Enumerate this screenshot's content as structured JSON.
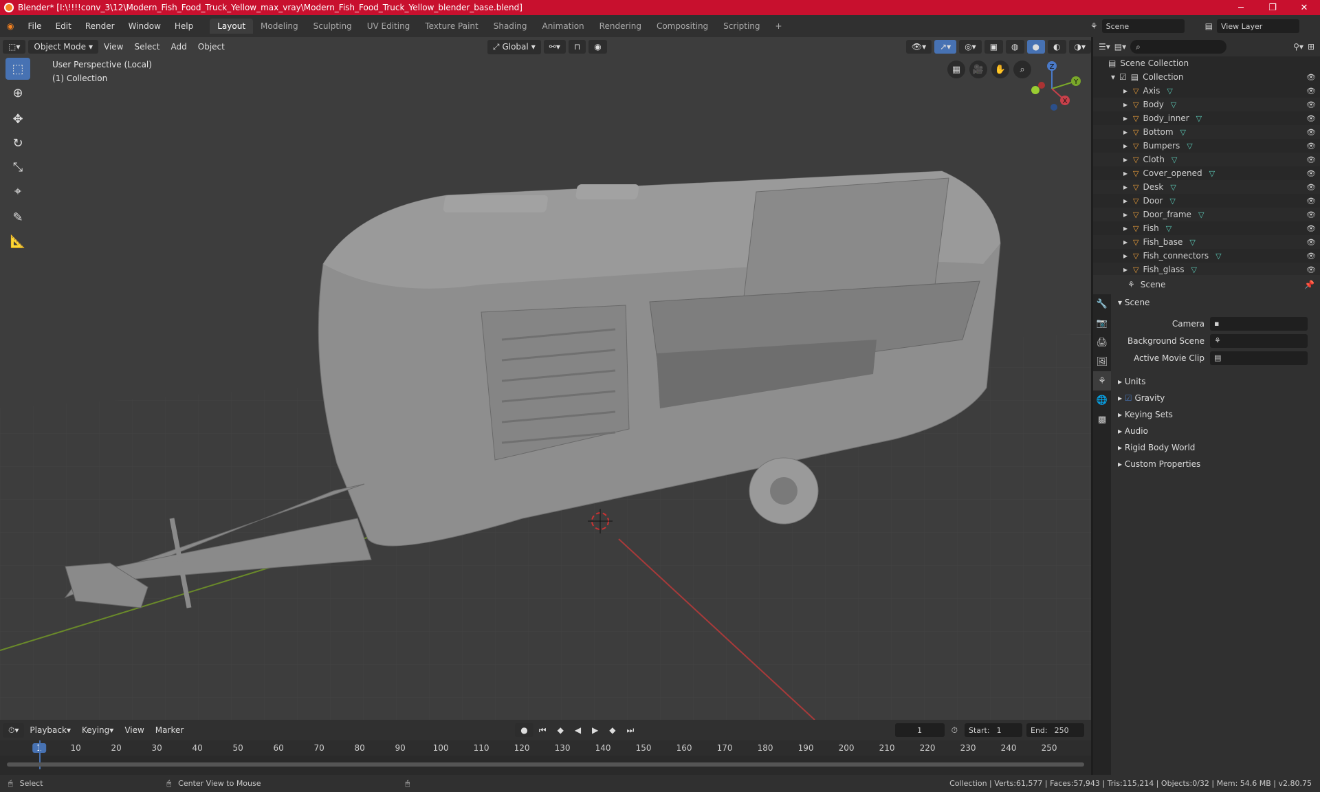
{
  "title": "Blender* [I:\\!!!!conv_3\\12\\Modern_Fish_Food_Truck_Yellow_max_vray\\Modern_Fish_Food_Truck_Yellow_blender_base.blend]",
  "menu": [
    "File",
    "Edit",
    "Render",
    "Window",
    "Help"
  ],
  "workspaces": [
    "Layout",
    "Modeling",
    "Sculpting",
    "UV Editing",
    "Texture Paint",
    "Shading",
    "Animation",
    "Rendering",
    "Compositing",
    "Scripting"
  ],
  "active_workspace": "Layout",
  "scene_name": "Scene",
  "view_layer": "View Layer",
  "viewport": {
    "mode": "Object Mode",
    "menus": [
      "View",
      "Select",
      "Add",
      "Object"
    ],
    "orientation": "Global",
    "info_line1": "User Perspective (Local)",
    "info_line2": "(1) Collection",
    "gizmo": {
      "x": "X",
      "y": "Y",
      "z": "Z"
    }
  },
  "outliner": {
    "root": "Scene Collection",
    "collection": "Collection",
    "objects": [
      "Axis",
      "Body",
      "Body_inner",
      "Bottom",
      "Bumpers",
      "Cloth",
      "Cover_opened",
      "Desk",
      "Door",
      "Door_frame",
      "Fish",
      "Fish_base",
      "Fish_connectors",
      "Fish_glass"
    ]
  },
  "properties": {
    "header": "Scene",
    "section": "Scene",
    "fields": [
      {
        "label": "Camera",
        "value": ""
      },
      {
        "label": "Background Scene",
        "value": ""
      },
      {
        "label": "Active Movie Clip",
        "value": ""
      }
    ],
    "subsections": [
      "Units",
      "Gravity",
      "Keying Sets",
      "Audio",
      "Rigid Body World",
      "Custom Properties"
    ]
  },
  "timeline": {
    "menus": [
      "Playback",
      "Keying",
      "View",
      "Marker"
    ],
    "current_frame": "1",
    "start_label": "Start:",
    "start": "1",
    "end_label": "End:",
    "end": "250",
    "ticks": [
      "1",
      "10",
      "20",
      "30",
      "40",
      "50",
      "60",
      "70",
      "80",
      "90",
      "100",
      "110",
      "120",
      "130",
      "140",
      "150",
      "160",
      "170",
      "180",
      "190",
      "200",
      "210",
      "220",
      "230",
      "240",
      "250"
    ]
  },
  "status": {
    "left": "Select",
    "middle": "Center View to Mouse",
    "right": "Collection | Verts:61,577 | Faces:57,943 | Tris:115,214 | Objects:0/32 | Mem: 54.6 MB | v2.80.75"
  }
}
